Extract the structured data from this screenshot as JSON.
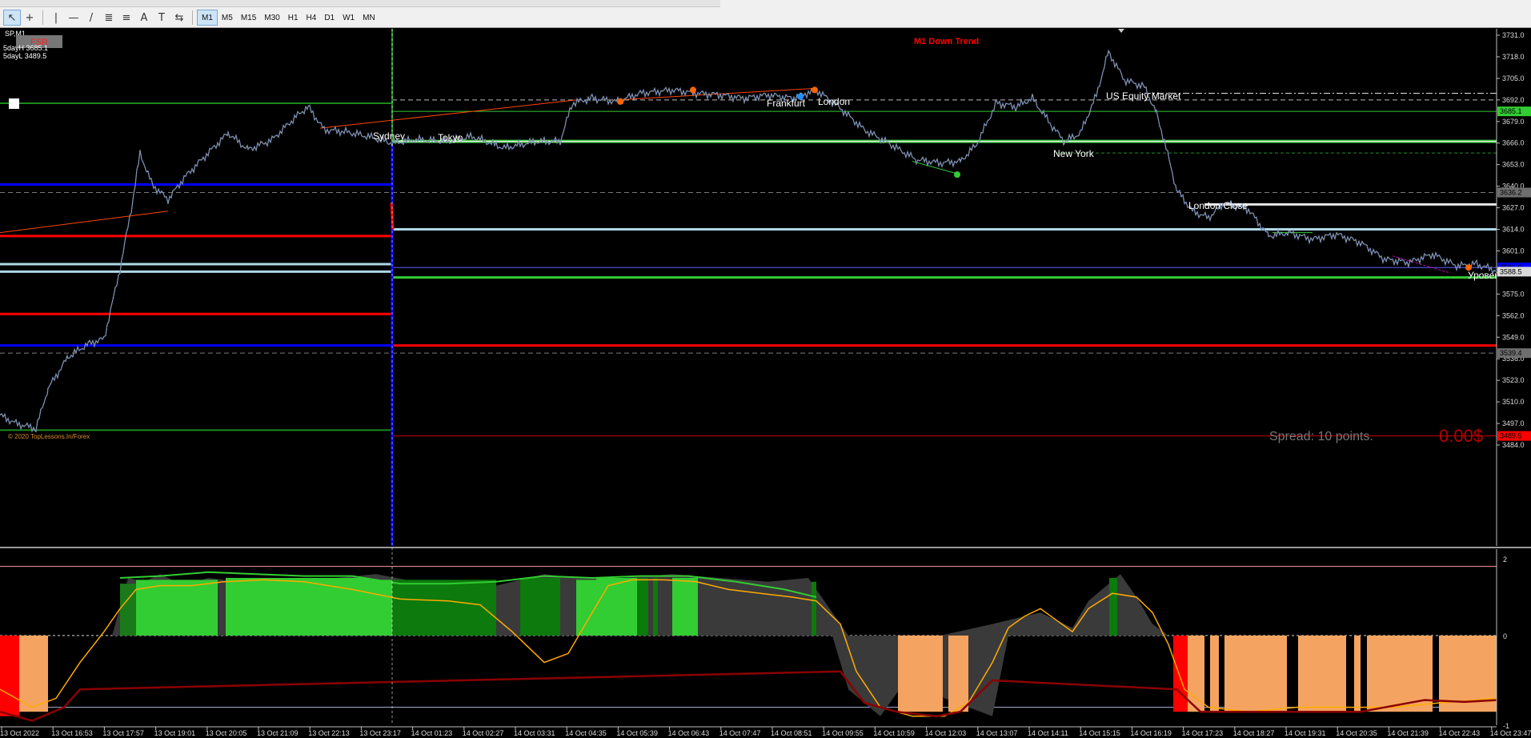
{
  "toolbar": {
    "tools": [
      {
        "name": "cursor",
        "glyph": "↖"
      },
      {
        "name": "crosshair",
        "glyph": "+"
      },
      {
        "name": "vertical-line",
        "glyph": "|"
      },
      {
        "name": "horizontal-line",
        "glyph": "—"
      },
      {
        "name": "trendline",
        "glyph": "/"
      },
      {
        "name": "equidistant-channel",
        "glyph": "≣"
      },
      {
        "name": "fibonacci",
        "glyph": "≡"
      },
      {
        "name": "text",
        "glyph": "A"
      },
      {
        "name": "text-label",
        "glyph": "T"
      },
      {
        "name": "arrows",
        "glyph": "⇆"
      }
    ],
    "timeframes": [
      "M1",
      "M5",
      "M15",
      "M30",
      "H1",
      "H4",
      "D1",
      "W1",
      "MN"
    ],
    "active_timeframe": "M1"
  },
  "chart": {
    "symbol": "SP,M1",
    "fsr_label": "FSR",
    "five_day_high": "5dayH 3685.1",
    "five_day_low": "5dayL 3489.5",
    "trend_text": "M1 Down Trend",
    "copyright": "© 2020 TopLessons.In/Forex",
    "spread": "Spread: 10 points.",
    "profit": "0.00$",
    "sessions": [
      {
        "name": "Sydney"
      },
      {
        "name": "Tokyo"
      },
      {
        "name": "Frankfurt"
      },
      {
        "name": "London"
      },
      {
        "name": "New York"
      },
      {
        "name": "US Equity Market"
      },
      {
        "name": "London Close"
      },
      {
        "name": "Уровень"
      }
    ],
    "price_axis": [
      "3731.0",
      "3718.0",
      "3705.0",
      "3692.0",
      "3679.0",
      "3666.0",
      "3653.0",
      "3640.0",
      "3627.0",
      "3614.0",
      "3601.0",
      "3588.0",
      "3575.0",
      "3562.0",
      "3549.0",
      "3536.0",
      "3523.0",
      "3510.0",
      "3497.0",
      "3484.0"
    ],
    "price_tags": [
      {
        "text": "3685.1",
        "bg": "#32cd32"
      },
      {
        "text": "3636.2",
        "bg": "#6e6e6e"
      },
      {
        "text": "3591.0",
        "bg": "#0000ff"
      },
      {
        "text": "3588.5",
        "bg": "#d9d9d9"
      },
      {
        "text": "3539.4",
        "bg": "#6e6e6e"
      },
      {
        "text": "3489.5",
        "bg": "#ff0000"
      }
    ],
    "time_axis": [
      "13 Oct 2022",
      "13 Oct 16:53",
      "13 Oct 17:57",
      "13 Oct 19:01",
      "13 Oct 20:05",
      "13 Oct 21:09",
      "13 Oct 22:13",
      "13 Oct 23:17",
      "14 Oct 01:23",
      "14 Oct 02:27",
      "14 Oct 03:31",
      "14 Oct 04:35",
      "14 Oct 05:39",
      "14 Oct 06:43",
      "14 Oct 07:47",
      "14 Oct 08:51",
      "14 Oct 09:55",
      "14 Oct 10:59",
      "14 Oct 12:03",
      "14 Oct 13:07",
      "14 Oct 14:11",
      "14 Oct 15:15",
      "14 Oct 16:19",
      "14 Oct 17:23",
      "14 Oct 18:27",
      "14 Oct 19:31",
      "14 Oct 20:35",
      "14 Oct 21:39",
      "14 Oct 22:43",
      "14 Oct 23:47"
    ],
    "indicator_axis": [
      "2",
      "0",
      "-1"
    ]
  }
}
